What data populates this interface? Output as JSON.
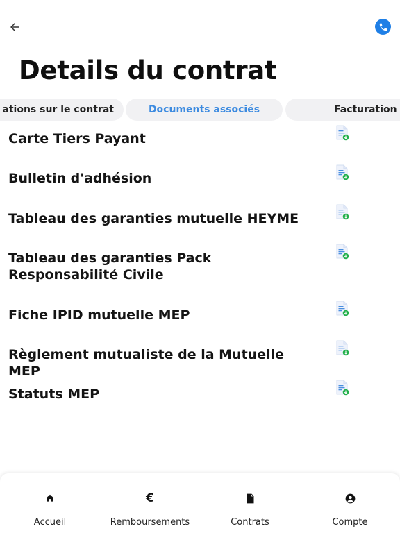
{
  "header": {
    "back_icon": "arrow-left-icon",
    "phone_icon": "phone-icon",
    "title": "Details du contrat"
  },
  "colors": {
    "accent": "#1f7fe6",
    "active_tab_text": "#3d8be0",
    "tab_background": "#f1f1f3",
    "doc_badge": "#22b04b"
  },
  "tabs": [
    {
      "label": "Informations sur le contrat",
      "visible_label": "ations sur le contrat",
      "active": false
    },
    {
      "label": "Documents associés",
      "active": true
    },
    {
      "label": "Facturation",
      "active": false
    }
  ],
  "documents": [
    {
      "title": "Carte Tiers Payant",
      "icon": "document-download-icon"
    },
    {
      "title": "Bulletin d'adhésion",
      "icon": "document-download-icon"
    },
    {
      "title": "Tableau des garanties mutuelle HEYME",
      "icon": "document-download-icon"
    },
    {
      "title": "Tableau des garanties Pack Responsabilité Civile",
      "icon": "document-download-icon"
    },
    {
      "title": "Fiche IPID mutuelle MEP",
      "icon": "document-download-icon"
    },
    {
      "title": "Règlement mutualiste de la Mutuelle MEP",
      "icon": "document-download-icon"
    },
    {
      "title": "Statuts MEP",
      "icon": "document-download-icon"
    }
  ],
  "bottom_nav": [
    {
      "label": "Accueil",
      "icon": "home-icon"
    },
    {
      "label": "Remboursements",
      "icon": "euro-icon",
      "glyph": "€"
    },
    {
      "label": "Contrats",
      "icon": "document-icon"
    },
    {
      "label": "Compte",
      "icon": "account-circle-icon"
    }
  ]
}
